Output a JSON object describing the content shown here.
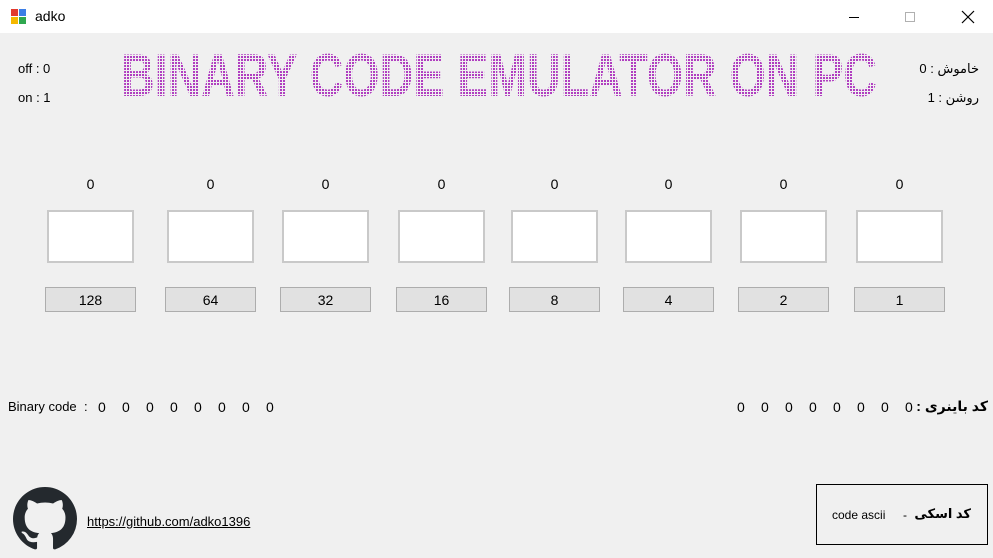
{
  "window": {
    "title": "adko"
  },
  "legend_left": {
    "off": "off : 0",
    "on": "on : 1"
  },
  "legend_right": {
    "off": "خاموش : 0",
    "on": "روشن : 1"
  },
  "banner": {
    "text": "BINARY CODE EMULATOR ON PC",
    "color": "#b03ec0"
  },
  "bits": [
    {
      "state": "0",
      "weight": "128"
    },
    {
      "state": "0",
      "weight": "64"
    },
    {
      "state": "0",
      "weight": "32"
    },
    {
      "state": "0",
      "weight": "16"
    },
    {
      "state": "0",
      "weight": "8"
    },
    {
      "state": "0",
      "weight": "4"
    },
    {
      "state": "0",
      "weight": "2"
    },
    {
      "state": "0",
      "weight": "1"
    }
  ],
  "binary_left": {
    "label": "Binary code",
    "separator": ":",
    "digits": [
      "0",
      "0",
      "0",
      "0",
      "0",
      "0",
      "0",
      "0"
    ]
  },
  "binary_right": {
    "label": "کد باینری :",
    "digits": [
      "0",
      "0",
      "0",
      "0",
      "0",
      "0",
      "0",
      "0"
    ]
  },
  "footer": {
    "link": "https://github.com/adko1396",
    "ascii_label_fa": "کد اسکی",
    "ascii_dash": "-",
    "ascii_label_en": "code ascii"
  },
  "icons": {
    "app": "app-icon",
    "github": "github-icon"
  }
}
